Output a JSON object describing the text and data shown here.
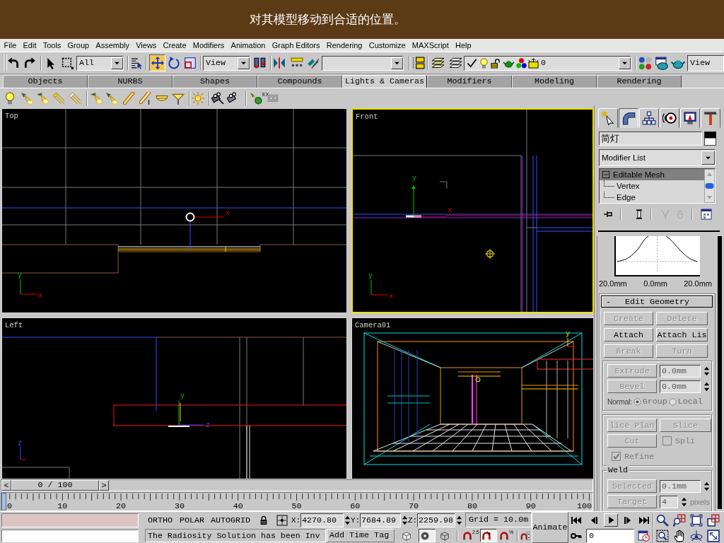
{
  "caption": "对其模型移动到合适的位置。",
  "menu": [
    "File",
    "Edit",
    "Tools",
    "Group",
    "Assembly",
    "Views",
    "Create",
    "Modifiers",
    "Animation",
    "Graph Editors",
    "Rendering",
    "Customize",
    "MAXScript",
    "Help"
  ],
  "main_toolbar": {
    "selection_filter": "All",
    "transform_tools": [
      {
        "kind": "move",
        "selected": true
      },
      {
        "kind": "rotate",
        "selected": false
      },
      {
        "kind": "scale",
        "selected": false
      }
    ],
    "reference_coordinate": "View",
    "layer": "0",
    "render_view": "View"
  },
  "tab_panel": {
    "tabs": [
      {
        "label": "Objects",
        "selected": false
      },
      {
        "label": "NURBS",
        "selected": false
      },
      {
        "label": "Shapes",
        "selected": false
      },
      {
        "label": "Compounds",
        "selected": false
      },
      {
        "label": "Lights & Cameras",
        "selected": true
      },
      {
        "label": "Modifiers",
        "selected": false
      },
      {
        "label": "Modeling",
        "selected": false
      },
      {
        "label": "Rendering",
        "selected": false
      }
    ],
    "tool_badge": "EX"
  },
  "viewports": [
    {
      "kind": "top",
      "label": "Top",
      "active": false,
      "gizmo_labels": [
        "x"
      ],
      "tripod_labels": [
        "y",
        "x"
      ]
    },
    {
      "kind": "front",
      "label": "Front",
      "active": true,
      "gizmo_labels": [
        "y",
        "x"
      ],
      "tripod_labels": [
        "y",
        "x"
      ]
    },
    {
      "kind": "left",
      "label": "Left",
      "active": false,
      "gizmo_labels": [
        "y",
        "z"
      ],
      "tripod_labels": [
        "z"
      ]
    },
    {
      "kind": "camera",
      "label": "Camera01",
      "active": false,
      "gizmo_labels": [
        "y"
      ]
    }
  ],
  "command_panel": {
    "tabs": [
      {
        "kind": "create",
        "selected": false
      },
      {
        "kind": "modify",
        "selected": true
      },
      {
        "kind": "hierarchy",
        "selected": false
      },
      {
        "kind": "motion",
        "selected": false
      },
      {
        "kind": "display",
        "selected": false
      },
      {
        "kind": "utilities",
        "selected": false
      }
    ],
    "object_name": "简灯",
    "modifier_list": "Modifier List",
    "modifier_stack": [
      {
        "label": "Editable Mesh",
        "selected": true,
        "expanded": true,
        "children": [
          {
            "label": "Vertex",
            "selected": false
          },
          {
            "label": "Edge",
            "selected": false
          }
        ]
      }
    ],
    "stack_tools": [
      {
        "kind": "pin",
        "disabled": false
      },
      {
        "kind": "show-end-result",
        "disabled": false
      },
      {
        "kind": "make-unique",
        "disabled": true
      },
      {
        "kind": "remove-modifier",
        "disabled": true
      },
      {
        "kind": "configure",
        "disabled": false
      }
    ],
    "falloff_labels": [
      "20.0mm",
      "0.0mm",
      "20.0mm"
    ],
    "edit_geometry": {
      "toggle": "-",
      "title": "Edit Geometry",
      "buttons": [
        {
          "label": "Create",
          "disabled": true
        },
        {
          "label": "Delete",
          "disabled": true
        },
        {
          "label": "Attach",
          "disabled": false
        },
        {
          "label": "Attach Lis",
          "disabled": false
        },
        {
          "label": "Break",
          "disabled": true
        },
        {
          "label": "Turn",
          "disabled": true
        }
      ],
      "spinners": [
        {
          "label": "Extrude",
          "value": "0.0mm",
          "disabled": true
        },
        {
          "label": "Bevel",
          "value": "0.0mm",
          "disabled": true
        }
      ],
      "normal": {
        "label": "Normal:",
        "options": [
          {
            "label": "Group",
            "selected": true
          },
          {
            "label": "Local",
            "selected": false
          }
        ]
      },
      "slice_buttons": [
        {
          "label": "lice Plan",
          "disabled": true
        },
        {
          "label": "Slice",
          "disabled": true
        },
        {
          "label": "Cut",
          "disabled": true
        }
      ],
      "checkboxes": [
        {
          "label": "Spli",
          "checked": false,
          "disabled": true
        },
        {
          "label": "Refine",
          "checked": true,
          "disabled": true
        }
      ],
      "weld": {
        "title": "Weld",
        "spinners": [
          {
            "label": "Selected",
            "value": "0.1mm",
            "disabled": true
          },
          {
            "label": "Target",
            "value": "4",
            "unit": "pixels",
            "disabled": true
          }
        ]
      }
    }
  },
  "time_slider": {
    "previous": "<",
    "position": "0 / 100",
    "next": ">"
  },
  "track_bar": {
    "labels": [
      "0",
      "10",
      "20",
      "30",
      "40",
      "50",
      "60",
      "70",
      "80",
      "90",
      "100"
    ]
  },
  "status_bar": {
    "modes": [
      "ORTHO",
      "POLAR",
      "AUTOGRID"
    ],
    "coordinates": [
      {
        "label": "X:",
        "value": "4270.80"
      },
      {
        "label": "Y:",
        "value": "7684.89"
      },
      {
        "label": "Z:",
        "value": "2259.98"
      }
    ],
    "grid": "Grid = 10.0m",
    "prompt": "The Radiosity Solution has been Inv",
    "time_tag": "Add Time Tag",
    "toggles": [
      {
        "kind": "cube",
        "on": false
      },
      {
        "kind": "dotted-circle",
        "on": true
      },
      {
        "kind": "wire-cube",
        "on": false
      },
      {
        "kind": "snap",
        "on": false,
        "badge": "2.5"
      },
      {
        "kind": "angle-snap",
        "on": true
      },
      {
        "kind": "percent-snap",
        "on": false,
        "badge": "%"
      },
      {
        "kind": "spinner-snap",
        "on": false
      }
    ],
    "animate": "Animate",
    "frame": "0"
  }
}
